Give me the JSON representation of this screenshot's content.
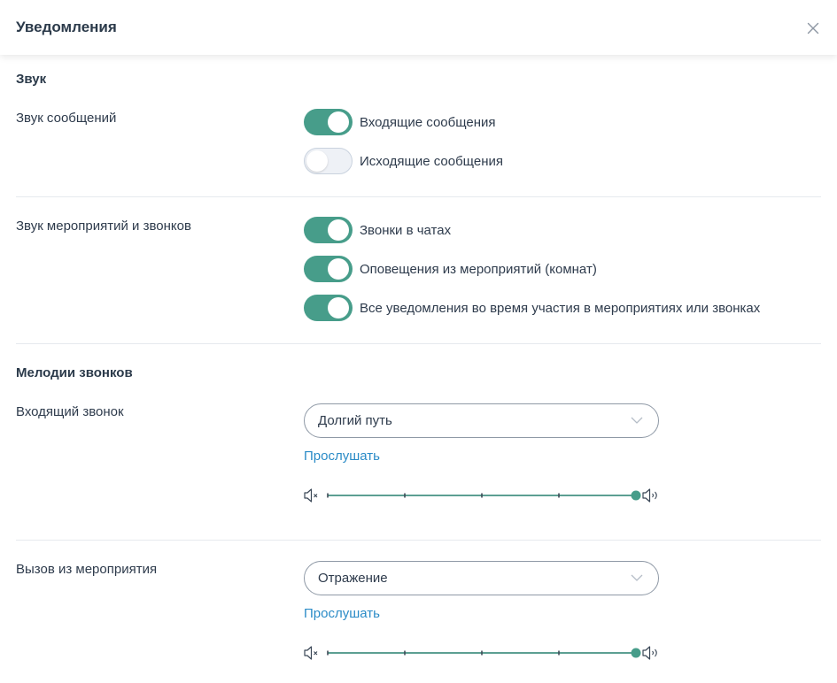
{
  "header": {
    "title": "Уведомления",
    "close_icon": "close-icon"
  },
  "sound": {
    "title": "Звук",
    "messages": {
      "label": "Звук сообщений",
      "toggles": [
        {
          "label": "Входящие сообщения",
          "on": true
        },
        {
          "label": "Исходящие сообщения",
          "on": false
        }
      ]
    },
    "events": {
      "label": "Звук мероприятий и звонков",
      "toggles": [
        {
          "label": "Звонки в чатах",
          "on": true
        },
        {
          "label": "Оповещения из мероприятий (комнат)",
          "on": true
        },
        {
          "label": "Все уведомления во время участия в мероприятиях или звонках",
          "on": true
        }
      ]
    }
  },
  "ringtones": {
    "title": "Мелодии звонков",
    "incoming": {
      "label": "Входящий звонок",
      "selected": "Долгий путь",
      "listen": "Прослушать",
      "volume": 1.0
    },
    "event_call": {
      "label": "Вызов из мероприятия",
      "selected": "Отражение",
      "listen": "Прослушать",
      "volume": 1.0
    }
  },
  "colors": {
    "accent": "#479d8a",
    "link": "#2a8bc7",
    "text": "#2e3b4c",
    "toggle_off": "#eef1f6"
  },
  "icons": {
    "mute": "volume-mute-icon",
    "max": "volume-max-icon",
    "chevron": "chevron-down-icon"
  }
}
